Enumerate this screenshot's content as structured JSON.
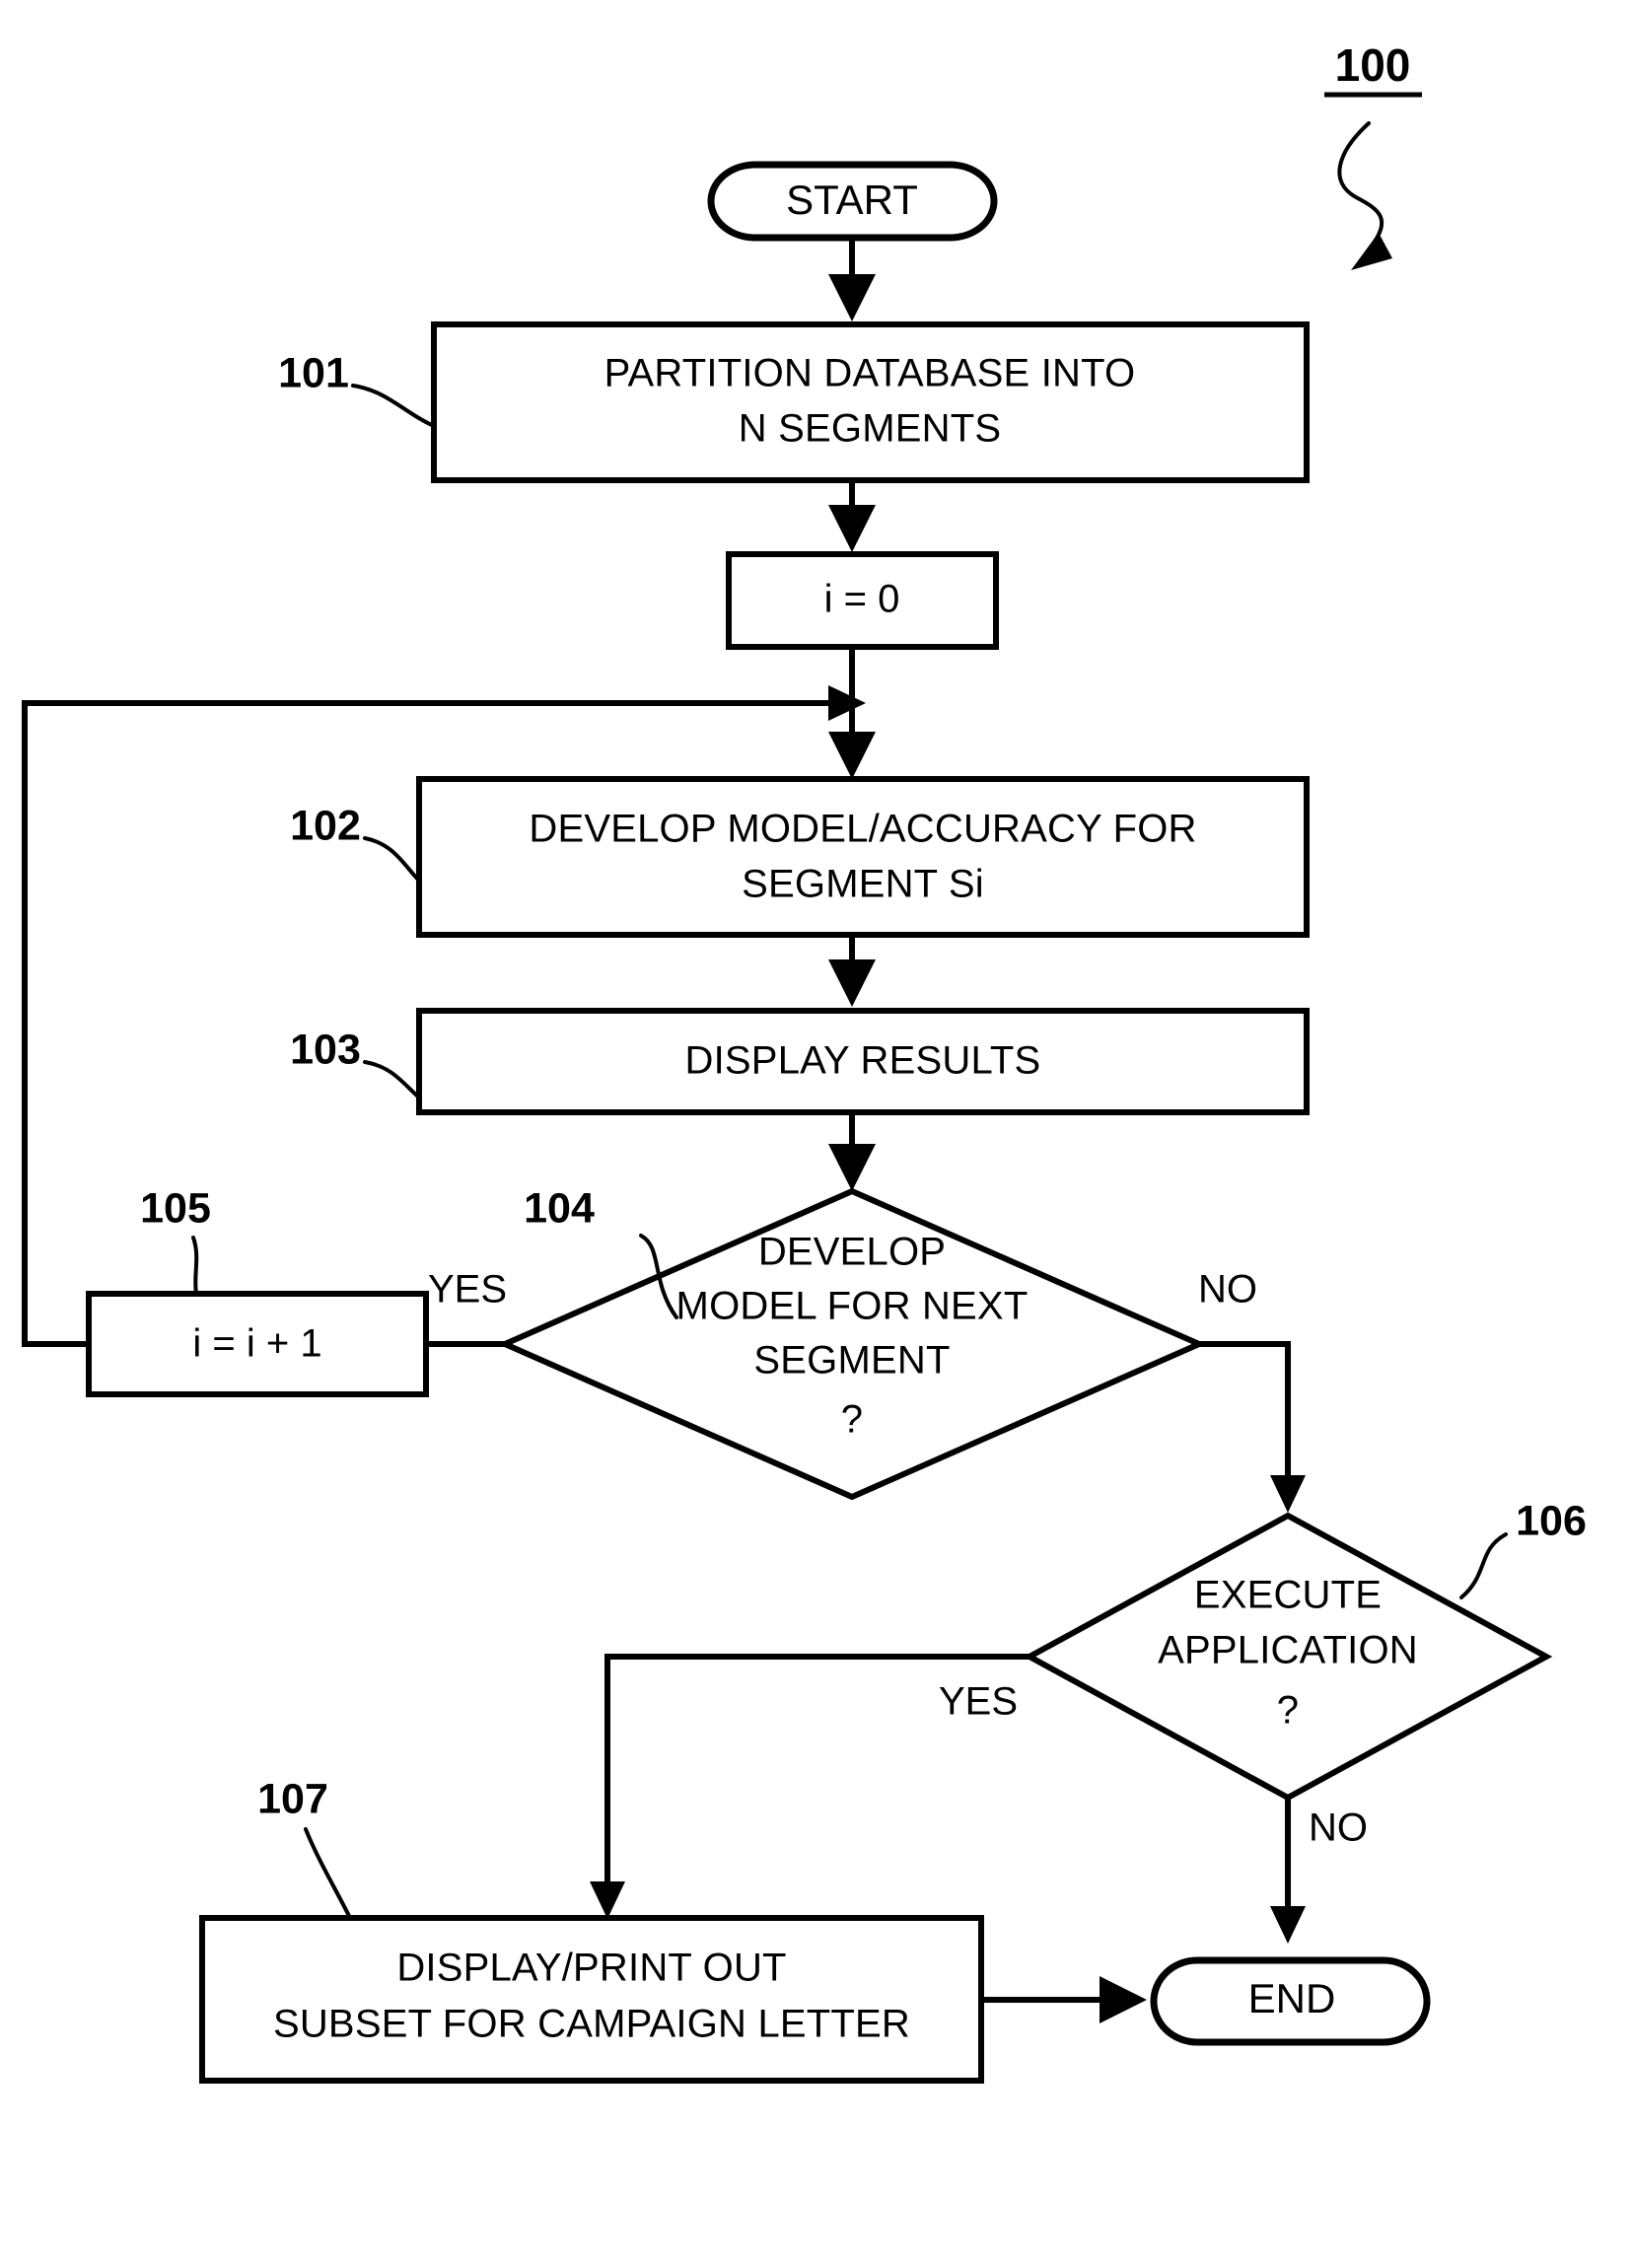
{
  "figure": {
    "number": "100",
    "underlined": true
  },
  "nodes": {
    "start": {
      "id": "start",
      "label": "START",
      "type": "terminator"
    },
    "n101": {
      "id": "101",
      "ref": "101",
      "lines": [
        "PARTITION DATABASE INTO",
        "N SEGMENTS"
      ],
      "type": "process"
    },
    "init": {
      "id": "init",
      "lines": [
        "i = 0"
      ],
      "type": "process"
    },
    "n102": {
      "id": "102",
      "ref": "102",
      "lines": [
        "DEVELOP MODEL/ACCURACY FOR",
        "SEGMENT Si"
      ],
      "type": "process"
    },
    "n103": {
      "id": "103",
      "ref": "103",
      "lines": [
        "DISPLAY RESULTS"
      ],
      "type": "process"
    },
    "n104": {
      "id": "104",
      "ref": "104",
      "lines": [
        "DEVELOP",
        "MODEL FOR NEXT",
        "SEGMENT",
        "?"
      ],
      "type": "decision"
    },
    "n105": {
      "id": "105",
      "ref": "105",
      "lines": [
        "i = i + 1"
      ],
      "type": "process"
    },
    "n106": {
      "id": "106",
      "ref": "106",
      "lines": [
        "EXECUTE",
        "APPLICATION",
        "?"
      ],
      "type": "decision"
    },
    "n107": {
      "id": "107",
      "ref": "107",
      "lines": [
        "DISPLAY/PRINT OUT",
        "SUBSET FOR CAMPAIGN LETTER"
      ],
      "type": "process"
    },
    "end": {
      "id": "end",
      "label": "END",
      "type": "terminator"
    }
  },
  "edge_labels": {
    "yes_104": "YES",
    "no_104": "NO",
    "yes_106": "YES",
    "no_106": "NO"
  },
  "colors": {
    "stroke": "#000000",
    "fill": "#ffffff",
    "background": "#ffffff"
  }
}
